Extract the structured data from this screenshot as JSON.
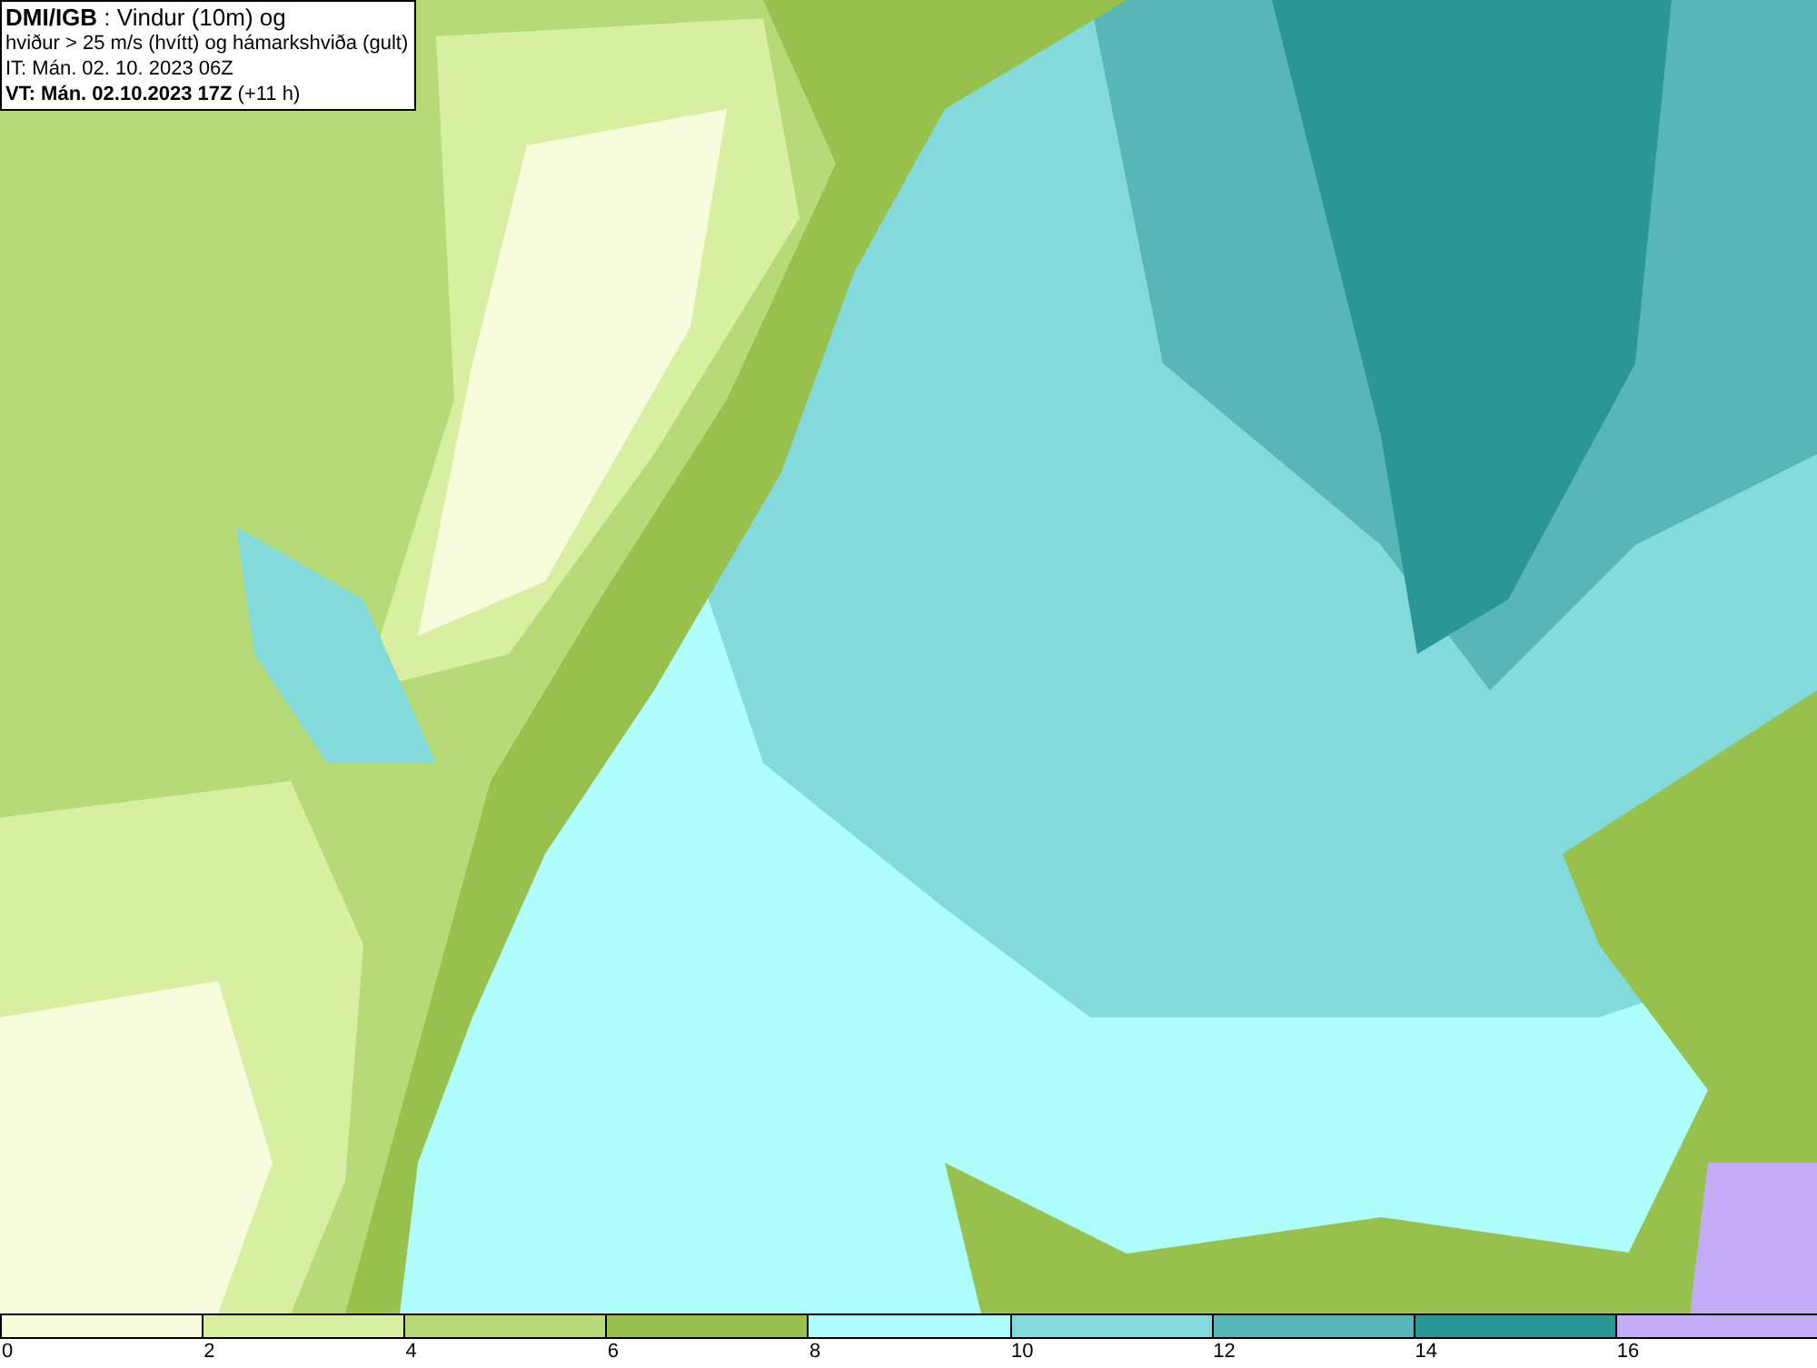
{
  "title_box": {
    "lines": [
      "**DMI/IGB** : Vindur (10m) og",
      "hviður > 25 m/s (hvítt) og hámarkshviða (gult)",
      "IT: Mán. 02. 10. 2023 06Z",
      "**VT: Mán. 02.10.2023 17Z** (+11 h)"
    ]
  },
  "legend": [
    {
      "label": "0",
      "color": "#f7fcdc"
    },
    {
      "label": "2",
      "color": "#d8efa2"
    },
    {
      "label": "4",
      "color": "#b7da78"
    },
    {
      "label": "6",
      "color": "#97c04c"
    },
    {
      "label": "8",
      "color": "#aefefe"
    },
    {
      "label": "10",
      "color": "#82dada"
    },
    {
      "label": "12",
      "color": "#58b6b6"
    },
    {
      "label": "14",
      "color": "#2b9696"
    },
    {
      "label": "16",
      "color": "#c2acf6"
    }
  ]
}
